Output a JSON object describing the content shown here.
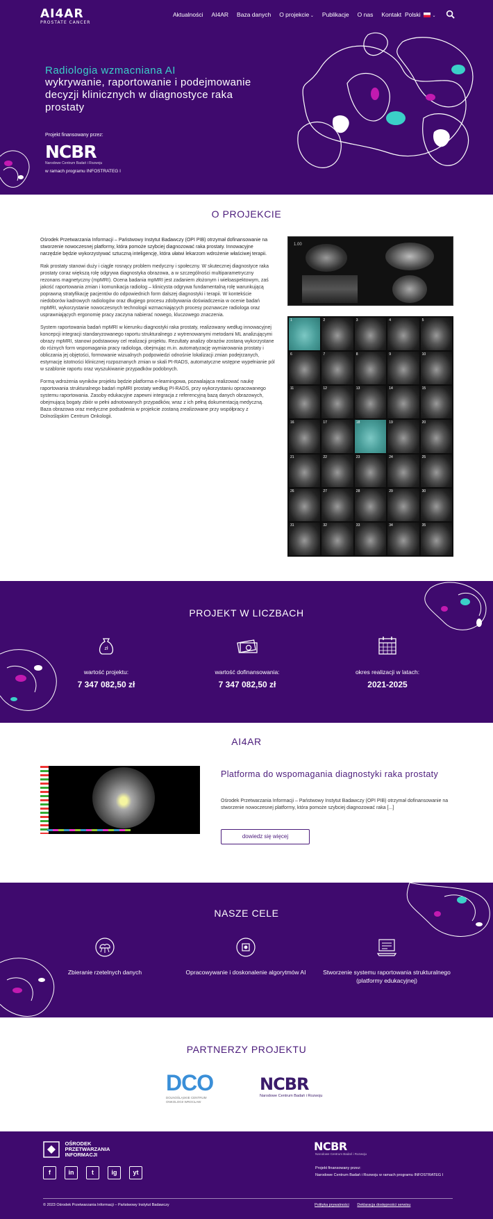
{
  "nav": {
    "logo_main": "AI4AR",
    "logo_sub": "PROSTATE CANCER",
    "items": [
      "Aktualności",
      "AI4AR",
      "Baza danych",
      "O projekcie",
      "Publikacje",
      "O nas",
      "Kontakt"
    ],
    "language": "Polski"
  },
  "hero": {
    "subtitle": "Radiologia wzmacniana AI",
    "title": "wykrywanie, raportowanie i podejmowanie decyzji klinicznych w diagnostyce raka prostaty",
    "financed_label": "Projekt finansowany przez:",
    "ncbr": "NCBR",
    "ncbr_sub": "Narodowe Centrum Badań i Rozwoju",
    "program": "w ramach programu INFOSTRATEG I"
  },
  "about": {
    "title": "O PROJEKCIE",
    "p1": "Ośrodek Przetwarzania Informacji – Państwowy Instytut Badawczy (OPI PIB) otrzymał dofinansowanie na stworzenie nowoczesnej platformy, która pomoże szybciej diagnozować raka prostaty. Innowacyjne narzędzie będzie wykorzystywać sztuczną inteligencję, która ułatwi lekarzom wdrożenie właściwej terapii.",
    "p2": "Rak prostaty stanowi duży i ciągle rosnący problem medyczny i społeczny. W skutecznej diagnostyce raka prostaty coraz większą rolę odgrywa diagnostyka obrazowa, a w szczególności multiparametryczny rezonans magnetyczny (mpMRI). Ocena badania mpMRI jest zadaniem złożonym i wieloaspektowym, zaś jakość raportowania zmian i komunikacja radiolog – klinicysta odgrywa fundamentalną rolę warunkującą poprawną stratyfikację pacjentów do odpowiednich form dalszej diagnostyki i terapii. W kontekście niedoborów kadrowych radiologów oraz długiego procesu zdobywania doświadczenia w ocenie badań mpMRI, wykorzystanie nowoczesnych technologii wzmacniających procesy poznawcze radiologa oraz usprawniających ergonomię pracy zaczyna nabierać nowego, kluczowego znaczenia.",
    "p3": "System raportowania badań mpMRI w kierunku diagnostyki raka prostaty, realizowany według innowacyjnej koncepcji integracji standaryzowanego raportu strukturalnego z wytrenowanymi metodami ML analizującymi obrazy mpMRI, stanowi podstawowy cel realizacji projektu. Rezultaty analizy obrazów zostaną wykorzystane do różnych form wspomagania pracy radiologa, obejmując m.in. automatyzację wymiarowania prostaty i obliczania jej objętości, formowanie wizualnych podpowiedzi odnośnie lokalizacji zmian podejrzanych, estymację istotności klinicznej rozpoznanych zmian w skali PI-RADS, automatyczne wstępne wypełnianie pól w szablonie raportu oraz wyszukiwanie przypadków podobnych.",
    "p4": "Formą wdrożenia wyników projektu będzie platforma e-learningowa, pozwalająca realizować naukę raportowania strukturalnego badań mpMRI prostaty według PI-RADS, przy wykorzystaniu opracowanego systemu raportowania. Zasoby edukacyjne zapewni integracja z referencyjną bazą danych obrazowych, obejmującą bogaty zbiór w pełni adnotowanych przypadków, wraz z ich pełną dokumentacją medyczną. Baza obrazowa oraz medyczne podsadenia w projekcie zostaną zrealizowane przy współpracy z Dolnośląskim Centrum Onkologii.",
    "scan_label": "1.00",
    "grid_numbers": [
      "1",
      "2",
      "3",
      "4",
      "5",
      "6",
      "7",
      "8",
      "9",
      "10",
      "11",
      "12",
      "13",
      "14",
      "15",
      "16",
      "17",
      "18",
      "19",
      "20",
      "21",
      "22",
      "23",
      "24",
      "25",
      "26",
      "27",
      "28",
      "29",
      "30",
      "31",
      "32",
      "33",
      "34",
      "35"
    ]
  },
  "numbers": {
    "title": "PROJEKT W LICZBACH",
    "items": [
      {
        "icon": "money-bag-icon",
        "label": "wartość projektu:",
        "value": "7 347 082,50 zł"
      },
      {
        "icon": "banknotes-icon",
        "label": "wartość dofinansowania:",
        "value": "7 347 082,50 zł"
      },
      {
        "icon": "calendar-icon",
        "label": "okres realizacji w latach:",
        "value": "2021-2025"
      }
    ]
  },
  "ai4ar": {
    "title": "AI4AR",
    "card_title": "Platforma do wspomagania diagnostyki raka prostaty",
    "card_text": "Ośrodek Przetwarzania Informacji – Państwowy Instytut Badawczy (OPI PIB) otrzymał dofinansowanie na stworzenie nowoczesnej platformy, która pomoże szybciej diagnozować raka [...]",
    "button": "dowiedz się więcej"
  },
  "goals": {
    "title": "NASZE CELE",
    "items": [
      {
        "icon": "data-cloud-icon",
        "label": "Zbieranie rzetelnych danych"
      },
      {
        "icon": "ai-chip-icon",
        "label": "Opracowywanie i doskonalenie algorytmów AI"
      },
      {
        "icon": "report-system-icon",
        "label": "Stworzenie systemu raportowania strukturalnego (platformy edukacyjnej)"
      }
    ]
  },
  "partners": {
    "title": "PARTNERZY PROJEKTU",
    "dco": "DCO",
    "dco_sub": "DOLNOŚLĄSKIE CENTRUM ONKOLOGII WROCŁAW",
    "ncbr": "NCBR",
    "ncbr_sub": "Narodowe Centrum Badań i Rozwoju"
  },
  "footer": {
    "opi": "OŚRODEK PRZETWARZANIA INFORMACJI",
    "ncbr": "NCBR",
    "ncbr_sub": "Narodowe Centrum Badań i Rozwoju",
    "financed": "Projekt finansowany przez:",
    "financed_detail": "Narodowe Centrum Badań i Rozwoju w ramach programu INFOSTRATEG I",
    "copyright": "© 2023 Ośrodek Przetwarzania Informacji – Państwowy Instytut Badawczy",
    "links": [
      "Polityka prywatności",
      "Deklaracja dostępności serwisu"
    ],
    "socials": [
      "f",
      "in",
      "t",
      "ig",
      "yt"
    ]
  },
  "colors": {
    "brand": "#3f0a6e",
    "accent": "#3bd0c8",
    "pink": "#c21ab0"
  }
}
